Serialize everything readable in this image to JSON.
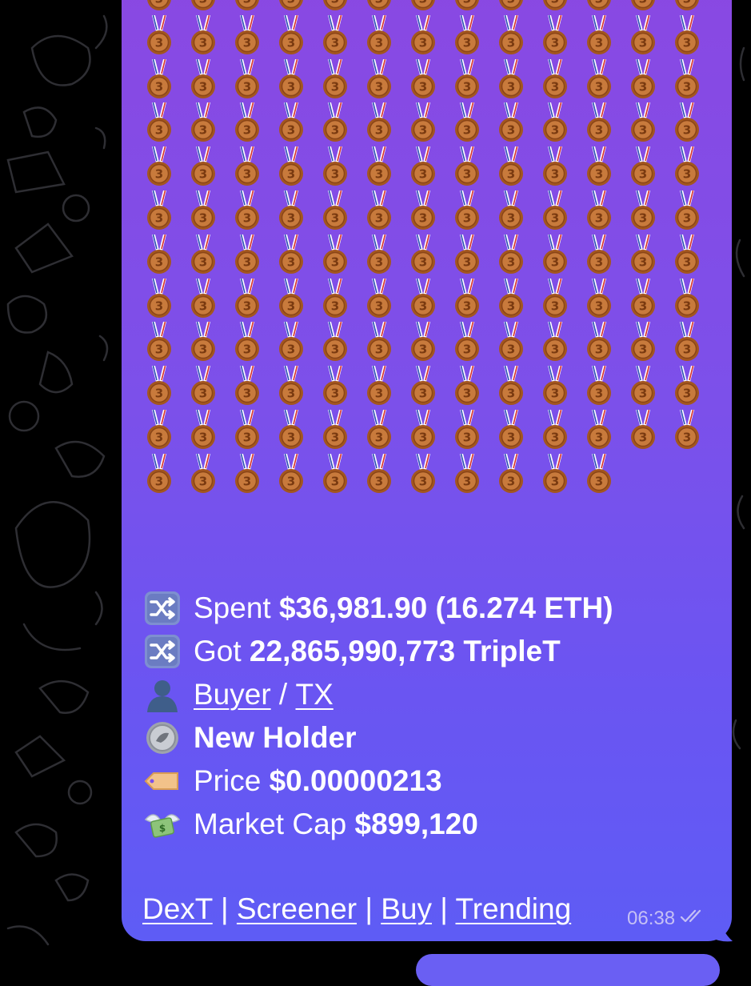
{
  "medal_grid": {
    "columns": 13,
    "rows": 12,
    "last_row_count": 11,
    "last_col_count": 11,
    "emoji_name": "bronze-medal-icon"
  },
  "message": {
    "lines": [
      {
        "icon": "shuffle-icon",
        "label": "Spent ",
        "value": "$36,981.90 (16.274 ETH)"
      },
      {
        "icon": "shuffle-icon",
        "label": "Got ",
        "value": "22,865,990,773 TripleT"
      },
      {
        "icon": "person-silhouette-icon",
        "link1": "Buyer",
        "sep": " / ",
        "link2": "TX"
      },
      {
        "icon": "coin-icon",
        "value": "New Holder"
      },
      {
        "icon": "price-tag-icon",
        "label": "Price ",
        "value": "$0.00000213"
      },
      {
        "icon": "money-with-wings-icon",
        "label": "Market Cap ",
        "value": "$899,120"
      }
    ],
    "links": [
      "DexT",
      "Screener",
      "Buy",
      "Trending"
    ],
    "link_separator": " | ",
    "time": "06:38",
    "status_icon": "double-check-icon"
  },
  "colors": {
    "background": "#000000",
    "bubble_top": "#8a48e2",
    "bubble_bottom": "#5e5cf5",
    "bronze": "#b0622c",
    "text": "#ffffff",
    "meta": "#c5c0f5"
  }
}
